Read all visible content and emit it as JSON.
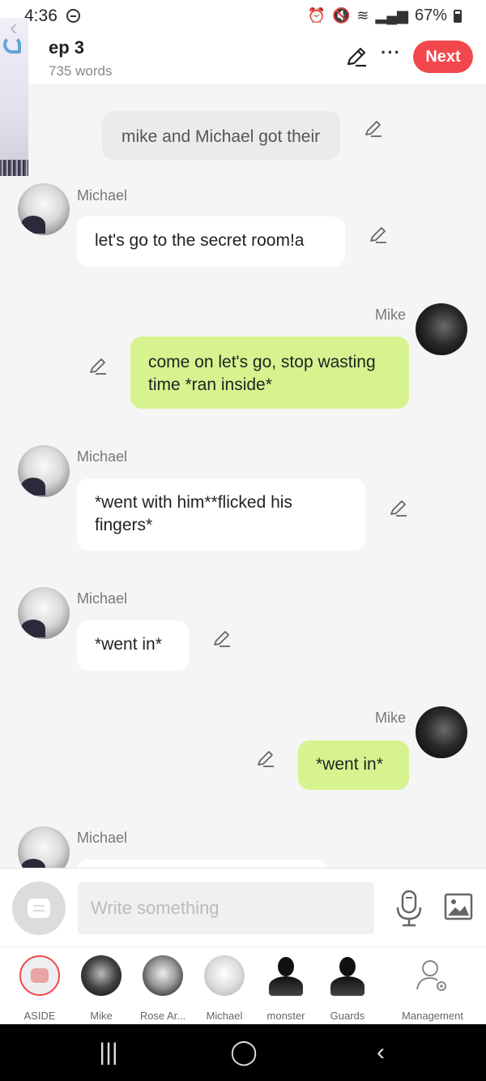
{
  "status_bar": {
    "time": "4:36",
    "battery": "67%"
  },
  "header": {
    "title": "ep 3",
    "word_count": "735 words",
    "next_label": "Next",
    "more_label": "···"
  },
  "messages": [
    {
      "type": "narration",
      "text": "mike and Michael got their"
    },
    {
      "type": "left",
      "speaker": "Michael",
      "text": "let's go to the secret room!a"
    },
    {
      "type": "right",
      "speaker": "Mike",
      "text": "come on let's go, stop wasting time *ran inside*"
    },
    {
      "type": "left",
      "speaker": "Michael",
      "text": "*went with him**flicked his fingers*"
    },
    {
      "type": "left",
      "speaker": "Michael",
      "text": "*went in*"
    },
    {
      "type": "right",
      "speaker": "Mike",
      "text": "*went in*"
    },
    {
      "type": "left",
      "speaker": "Michael",
      "text": ""
    }
  ],
  "composer": {
    "placeholder": "Write something"
  },
  "characters": [
    {
      "label": "ASIDE",
      "icon": "aside-icon"
    },
    {
      "label": "Mike",
      "icon": "avatar"
    },
    {
      "label": "Rose Ar...",
      "icon": "avatar"
    },
    {
      "label": "Michael",
      "icon": "avatar"
    },
    {
      "label": "monster",
      "icon": "silhouette-icon"
    },
    {
      "label": "Guards",
      "icon": "silhouette-icon"
    },
    {
      "label": "Management",
      "icon": "user-settings-icon"
    }
  ],
  "colors": {
    "accent": "#f2474c",
    "right_bubble": "#d6f38f",
    "left_bubble": "#ffffff",
    "narration_bubble": "#ebebeb"
  }
}
